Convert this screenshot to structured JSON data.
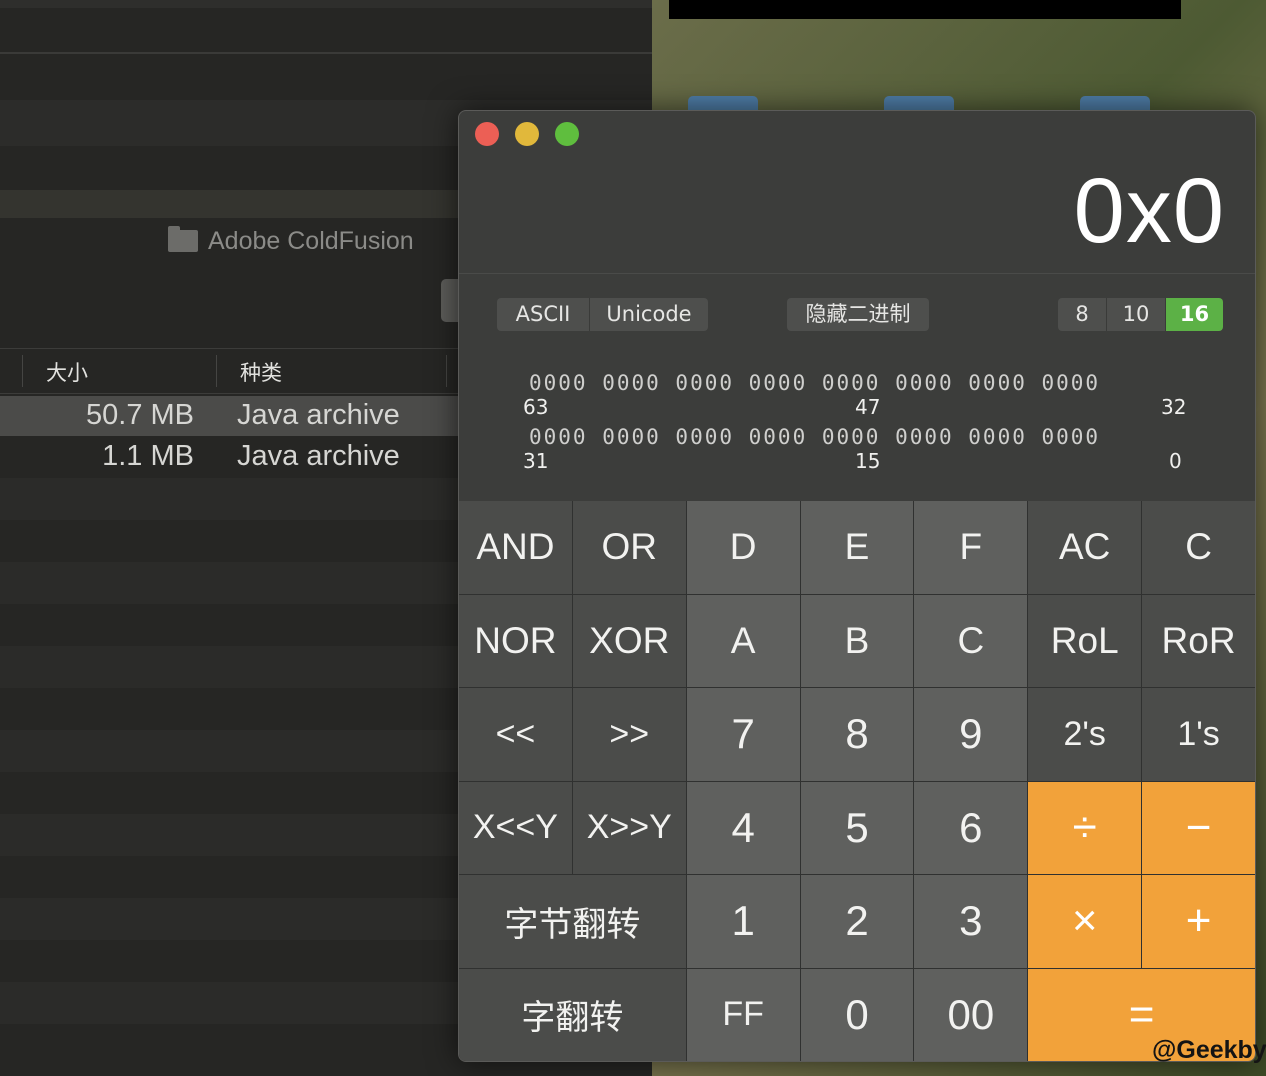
{
  "finder": {
    "folder_name": "Adobe ColdFusion",
    "columns": {
      "size": "大小",
      "kind": "种类"
    },
    "rows": [
      {
        "size": "50.7 MB",
        "kind": "Java archive"
      },
      {
        "size": "1.1 MB",
        "kind": "Java archive"
      }
    ]
  },
  "calculator": {
    "display": "0x0",
    "encoding_buttons": [
      "ASCII",
      "Unicode"
    ],
    "hide_binary_label": "隐藏二进制",
    "bases": [
      "8",
      "10",
      "16"
    ],
    "active_base": "16",
    "binary_rows": [
      {
        "bits": "0000 0000 0000 0000 0000 0000 0000 0000",
        "labels": [
          "63",
          "47",
          "32"
        ]
      },
      {
        "bits": "0000 0000 0000 0000 0000 0000 0000 0000",
        "labels": [
          "31",
          "15",
          "0"
        ]
      }
    ],
    "keys": {
      "and": "AND",
      "or": "OR",
      "d": "D",
      "e": "E",
      "f": "F",
      "ac": "AC",
      "c_clear": "C",
      "nor": "NOR",
      "xor": "XOR",
      "a": "A",
      "b": "B",
      "c_hex": "C",
      "rol": "RoL",
      "ror": "RoR",
      "shl": "<<",
      "shr": ">>",
      "k7": "7",
      "k8": "8",
      "k9": "9",
      "twos": "2's",
      "ones": "1's",
      "xshly": "X<<Y",
      "xshry": "X>>Y",
      "k4": "4",
      "k5": "5",
      "k6": "6",
      "divide": "÷",
      "minus": "−",
      "byte_flip": "字节翻转",
      "k1": "1",
      "k2": "2",
      "k3": "3",
      "multiply": "×",
      "plus": "+",
      "word_flip": "字翻转",
      "ff": "FF",
      "k0": "0",
      "k00": "00",
      "equals": "="
    },
    "colors": {
      "operator": "#f2a23a",
      "active_base": "#5cb146",
      "close": "#ec5f55",
      "minimize": "#e1b83b",
      "zoom": "#5fbe3e"
    }
  },
  "watermark": "@Geekby"
}
